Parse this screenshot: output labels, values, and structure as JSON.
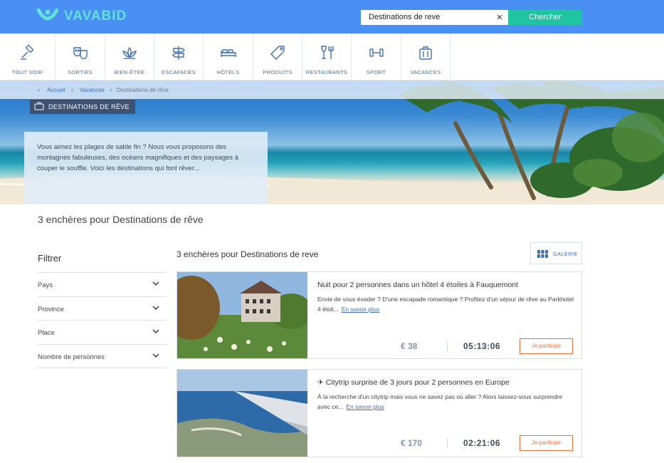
{
  "header": {
    "brand": "VAVABID",
    "search_value": "Destinations de reve",
    "search_button": "Chercher",
    "clear_glyph": "×"
  },
  "categories": [
    {
      "label": "TOUT VOIR",
      "icon": "gavel-icon"
    },
    {
      "label": "SORTIES",
      "icon": "theater-masks-icon"
    },
    {
      "label": "BIEN-ÊTRE",
      "icon": "lotus-icon"
    },
    {
      "label": "ESCAPADES",
      "icon": "signpost-icon"
    },
    {
      "label": "HÔTELS",
      "icon": "bed-icon"
    },
    {
      "label": "PRODUITS",
      "icon": "tag-icon"
    },
    {
      "label": "RESTAURANTS",
      "icon": "glass-fork-icon"
    },
    {
      "label": "SPORT",
      "icon": "dumbbell-icon"
    },
    {
      "label": "VACANCES",
      "icon": "suitcase-icon"
    }
  ],
  "breadcrumb": [
    "Accueil",
    "Vacances",
    "Destinations de rêve"
  ],
  "hero": {
    "tag": "DESTINATIONS DE RÊVE",
    "description": "Vous aimez les plages de sable fin ? Nous vous proposons des montagnes fabuleuses, des océans magnifiques et des paysages à couper le souffle. Voici les destinations qui font rêver..."
  },
  "page_heading": "3 enchères pour Destinations de rêve",
  "filters": {
    "title": "Filtrer",
    "items": [
      "Pays",
      "Province",
      "Place",
      "Nombre de personnes"
    ]
  },
  "results": {
    "title": "3 enchères pour Destinations de reve",
    "gallery_label": "GALERIE"
  },
  "cards": [
    {
      "title": "Nuit pour 2 personnes dans un hôtel 4 étoiles à Fauquemont",
      "description": "Envie de vous évader ? D'une escapade romantique ? Profitez d'un séjour de rêve au Parkhotel 4 étoil...",
      "link": "En savoir plus",
      "price": "€ 38",
      "timer": "05:13:06",
      "cta": "Je participe"
    },
    {
      "title": "✈ Citytrip surprise de 3 jours pour 2 personnes en Europe",
      "description": "À la recherche d'un citytrip mais vous ne savez pas où aller ? Alors laissez-vous surprendre avec ce...",
      "link": "En savoir plus",
      "price": "€ 170",
      "timer": "02:21:06",
      "cta": "Je participe"
    }
  ],
  "colors": {
    "header_blue": "#4a90f4",
    "accent_teal": "#20c3a2",
    "link_blue": "#3f6fb8",
    "cta_orange": "#f07040"
  }
}
